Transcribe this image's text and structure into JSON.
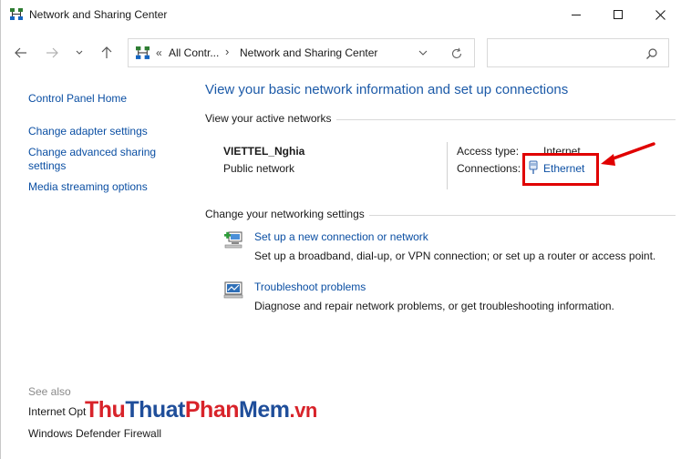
{
  "window": {
    "title": "Network and Sharing Center"
  },
  "address_bar": {
    "chevron": "«",
    "segment_1": "All Contr...",
    "separator": "›",
    "segment_2": "Network and Sharing Center"
  },
  "search": {
    "placeholder": "",
    "value": ""
  },
  "left_pane": {
    "links": [
      "Control Panel Home",
      "Change adapter settings",
      "Change advanced sharing",
      "settings",
      "Media streaming options"
    ],
    "see_also_label": "See also",
    "see_also_links": [
      "Internet Opt",
      "Windows Defender Firewall"
    ]
  },
  "main": {
    "title": "View your basic network information and set up connections",
    "active_networks_heading": "View your active networks",
    "network": {
      "name": "VIETTEL_Nghia",
      "category": "Public network",
      "access_type_label": "Access type:",
      "access_type_value": "Internet",
      "connections_label": "Connections:",
      "connections_value": "Ethernet"
    },
    "change_settings_heading": "Change your networking settings",
    "tasks": [
      {
        "link": "Set up a new connection or network",
        "description": "Set up a broadband, dial-up, or VPN connection; or set up a router or access point.",
        "icon": "new-connection-icon"
      },
      {
        "link": "Troubleshoot problems",
        "description": "Diagnose and repair network problems, or get troubleshooting information.",
        "icon": "troubleshoot-icon"
      }
    ]
  },
  "watermark": {
    "part1": "Thu",
    "part2": "Thuat",
    "part3": "Phan",
    "part4": "Mem",
    "part5": ".vn"
  },
  "colors": {
    "link": "#0b4fa3",
    "title_blue": "#1c5aa8",
    "highlight_red": "#e00000"
  }
}
